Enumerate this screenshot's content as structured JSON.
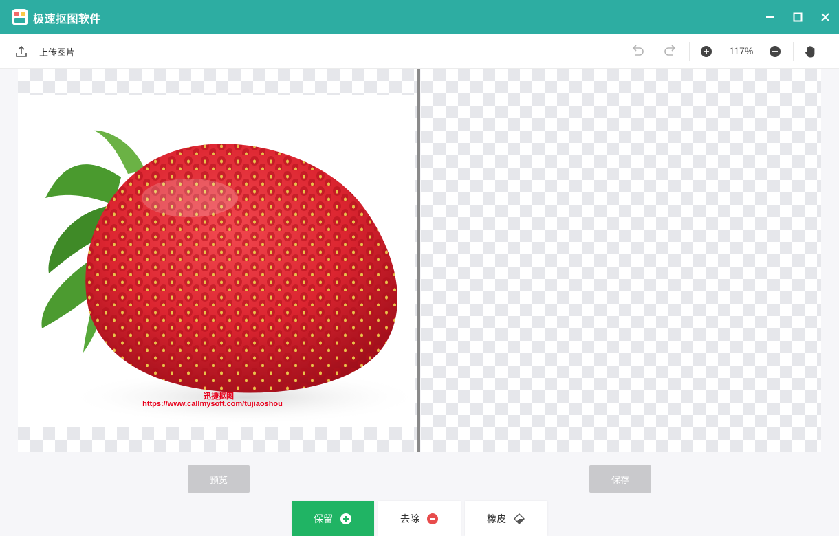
{
  "window": {
    "title": "极速抠图软件"
  },
  "toolbar": {
    "upload_label": "上传图片",
    "zoom_level": "117%",
    "icons": [
      "upload-icon",
      "undo-icon",
      "redo-icon",
      "zoom-in-icon",
      "zoom-out-icon",
      "hand-icon"
    ]
  },
  "canvas": {
    "watermark_line1": "迅捷抠图",
    "watermark_line2": "https://www.callmysoft.com/tujiaoshou"
  },
  "actions": {
    "preview_label": "预览",
    "save_label": "保存"
  },
  "modes": {
    "keep_label": "保留",
    "remove_label": "去除",
    "eraser_label": "橡皮",
    "selected": "保留"
  },
  "colors": {
    "titlebar": "#2dada2",
    "keep_button": "#20b464",
    "remove_icon": "#e84c4c",
    "disabled_button": "#c9c9cc"
  }
}
